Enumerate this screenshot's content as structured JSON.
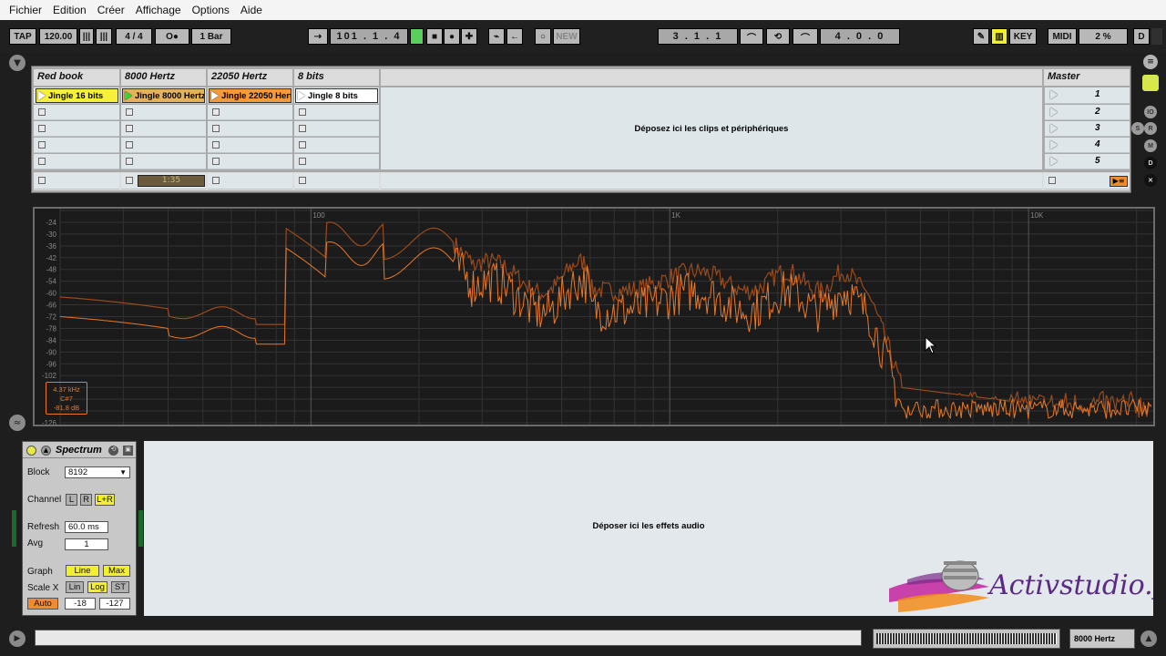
{
  "menu": [
    "Fichier",
    "Edition",
    "Créer",
    "Affichage",
    "Options",
    "Aide"
  ],
  "control": {
    "tap": "TAP",
    "tempo": "120.00",
    "signature": "4 / 4",
    "metronome": "O●",
    "quantize": "1 Bar",
    "position": "101 .  1 .  4",
    "new": "NEW",
    "loop_start": "3 .  1 .  1",
    "loop_length": "4 .  0 .  0",
    "key": "KEY",
    "midi": "MIDI",
    "cpu": "2 %",
    "d": "D"
  },
  "session": {
    "tracks": [
      {
        "name": "Red book",
        "clip": "Jingle 16 bits",
        "clip_color": "#f6f03a",
        "playing": false
      },
      {
        "name": "8000 Hertz",
        "clip": "Jingle 8000 Hertz",
        "clip_color": "#e5b15c",
        "playing": true
      },
      {
        "name": "22050 Hertz",
        "clip": "Jingle 22050 Hertz",
        "clip_color": "#f39a3a",
        "playing": false
      },
      {
        "name": "8 bits",
        "clip": "Jingle 8 bits",
        "clip_color": "#ffffff",
        "playing": false
      }
    ],
    "drop_hint": "Déposez ici les clips et périphériques",
    "master": "Master",
    "scenes": [
      "1",
      "2",
      "3",
      "4",
      "5"
    ],
    "playing_time": "1:35"
  },
  "spectrum": {
    "db_labels": [
      "-24",
      "-30",
      "-36",
      "-42",
      "-48",
      "-54",
      "-60",
      "-66",
      "-72",
      "-78",
      "-84",
      "-90",
      "-96",
      "-102",
      "-126"
    ],
    "freq_labels": [
      "100",
      "1K",
      "10K"
    ],
    "readout": [
      "4.37 kHz",
      "C#7",
      "-81.8 dB"
    ],
    "colors": {
      "line": "#e8782a",
      "max": "#9a4a1c"
    }
  },
  "device": {
    "title": "Spectrum",
    "block_label": "Block",
    "block_value": "8192",
    "channel_label": "Channel",
    "channel_opts": [
      "L",
      "R",
      "L+R"
    ],
    "refresh_label": "Refresh",
    "refresh_value": "60.0 ms",
    "avg_label": "Avg",
    "avg_value": "1",
    "graph_label": "Graph",
    "graph_opts": [
      "Line",
      "Max"
    ],
    "scalex_label": "Scale X",
    "scalex_opts": [
      "Lin",
      "Log",
      "ST"
    ],
    "auto": "Auto",
    "range_hi": "-18",
    "range_lo": "-127"
  },
  "fx_hint": "Déposer ici les effets audio",
  "status": {
    "track": "8000 Hertz"
  },
  "watermark": "Activstudio.fr"
}
